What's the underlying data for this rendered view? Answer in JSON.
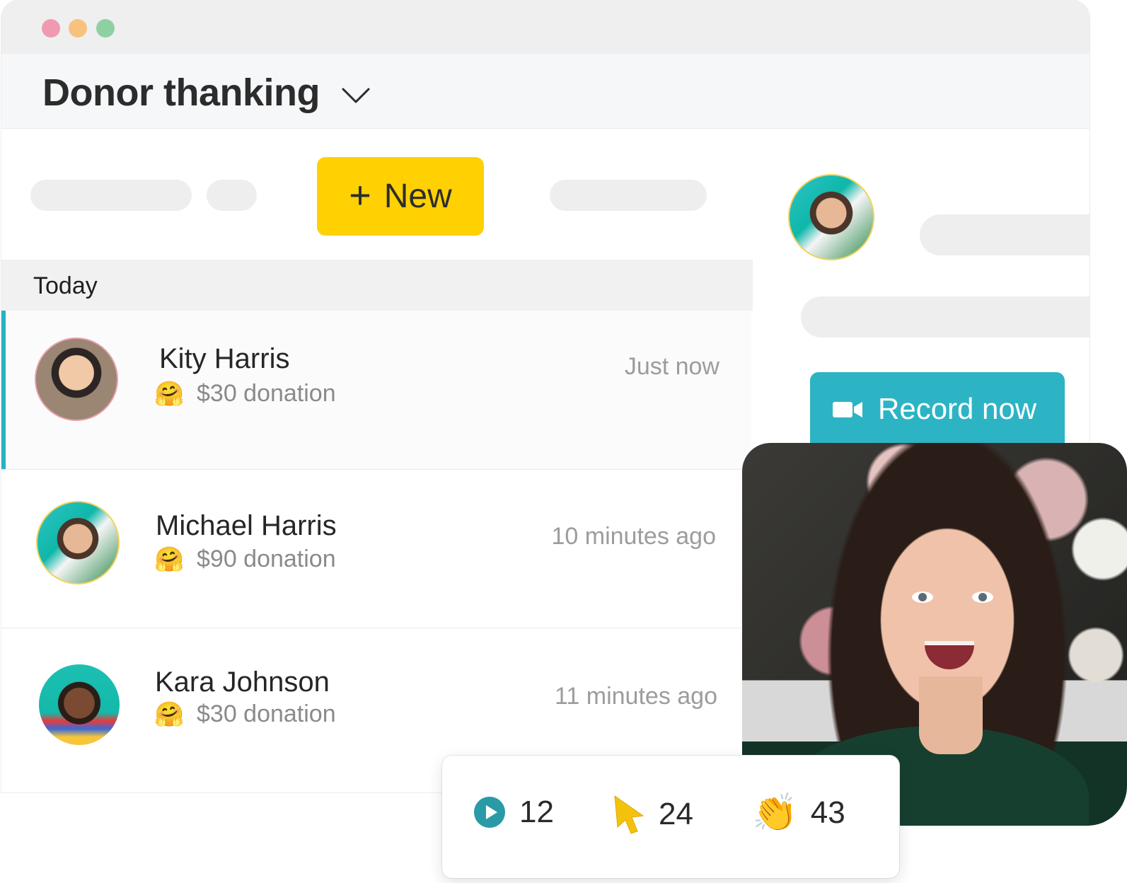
{
  "header": {
    "title": "Donor thanking"
  },
  "toolbar": {
    "new_label": "New"
  },
  "section": {
    "label": "Today"
  },
  "donations": [
    {
      "name": "Kity Harris",
      "amount": "$30 donation",
      "time": "Just now",
      "emoji": "🤗"
    },
    {
      "name": "Michael Harris",
      "amount": "$90 donation",
      "time": "10 minutes ago",
      "emoji": "🤗"
    },
    {
      "name": "Kara Johnson",
      "amount": "$30 donation",
      "time": "11 minutes ago",
      "emoji": "🤗"
    }
  ],
  "panel": {
    "record_label": "Record now"
  },
  "stats": {
    "views": "12",
    "clicks": "24",
    "claps": "43",
    "clap_emoji": "👏"
  },
  "colors": {
    "accent": "#2cb4c4",
    "primary_button": "#ffd103"
  }
}
